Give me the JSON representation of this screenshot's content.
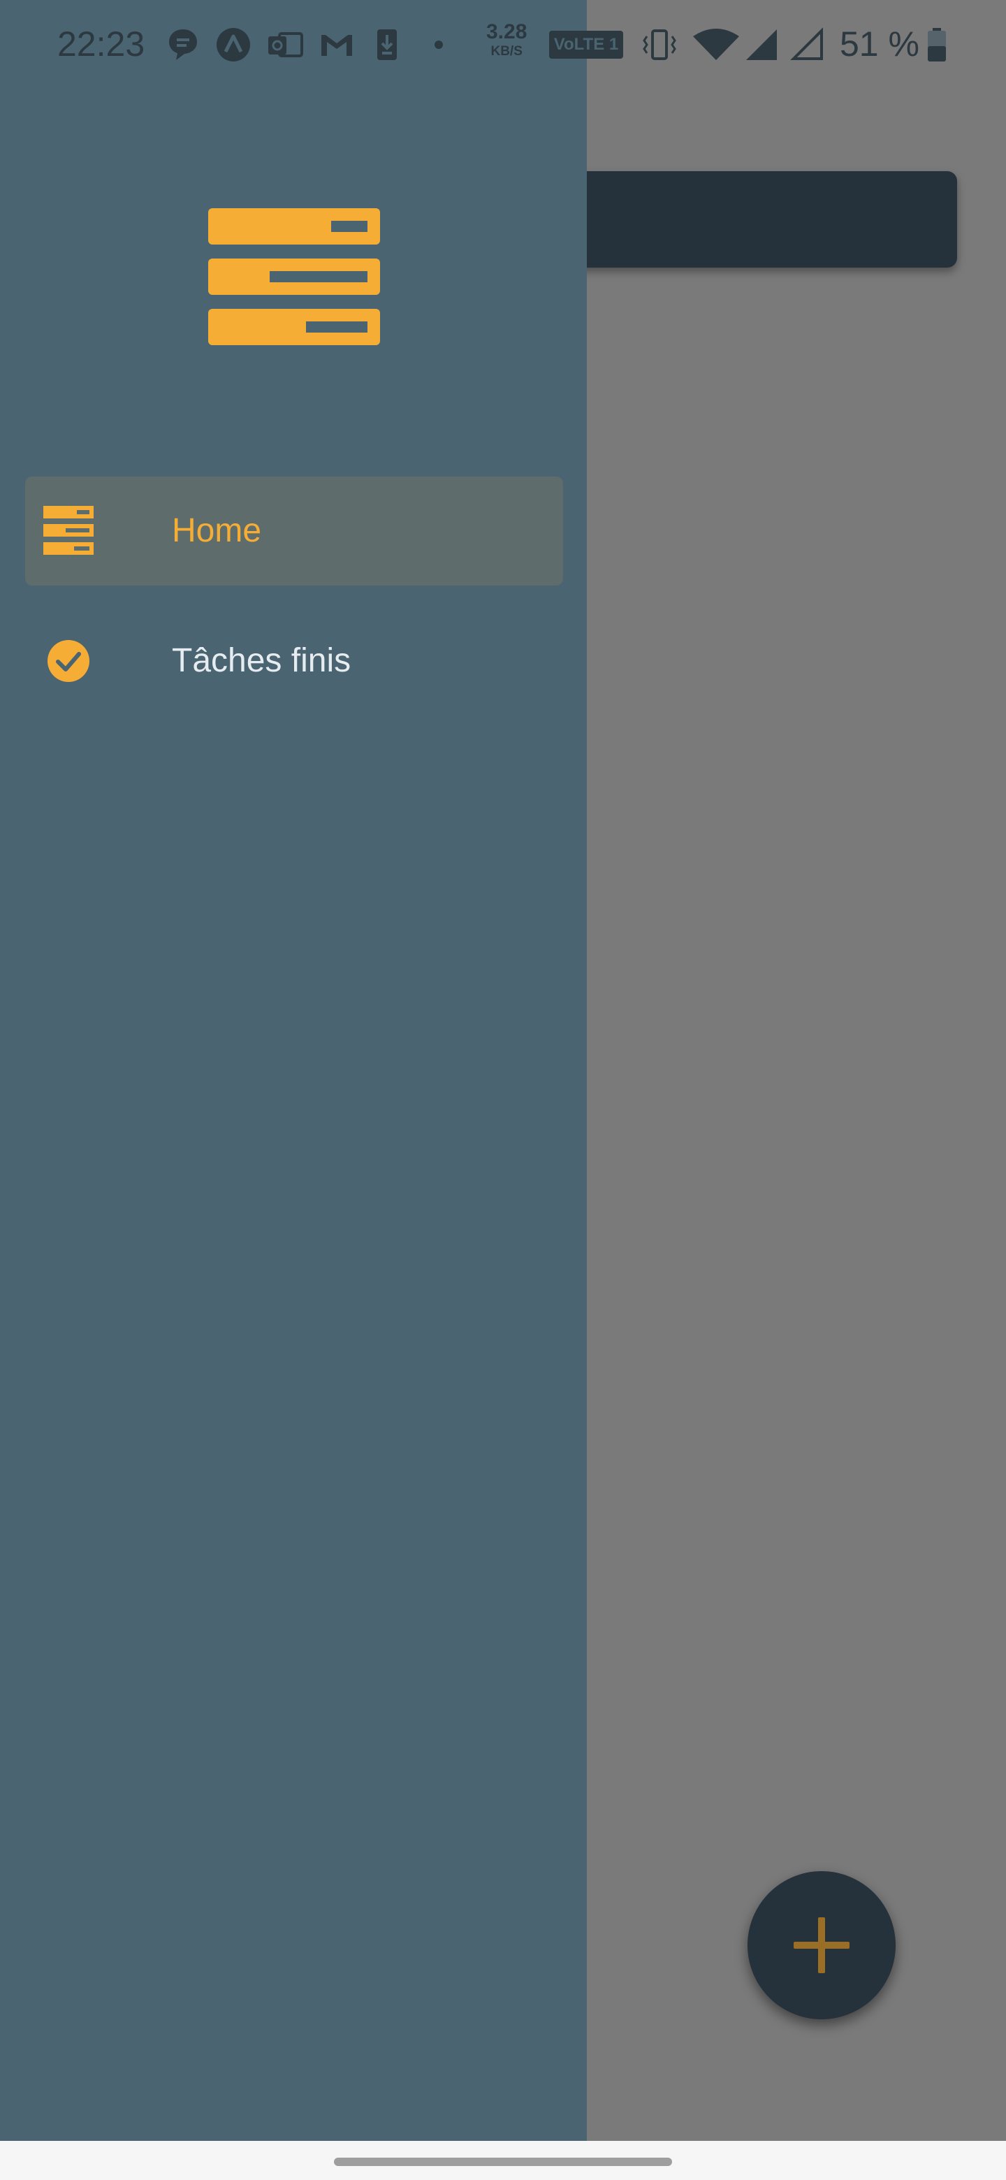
{
  "status_bar": {
    "time": "22:23",
    "net_speed_value": "3.28",
    "net_speed_unit": "KB/S",
    "volte_label": "VoLTE 1",
    "battery_text": "51 %"
  },
  "drawer": {
    "items": [
      {
        "label": "Home",
        "icon": "list-icon",
        "active": true
      },
      {
        "label": "Tâches finis",
        "icon": "check-circle-icon",
        "active": false
      }
    ]
  },
  "fab": {
    "icon": "plus-icon"
  },
  "colors": {
    "accent": "#f6ad36",
    "drawer_bg": "#4a6472",
    "dark_surface": "#25323c",
    "scrim": "#7a7a7a"
  }
}
